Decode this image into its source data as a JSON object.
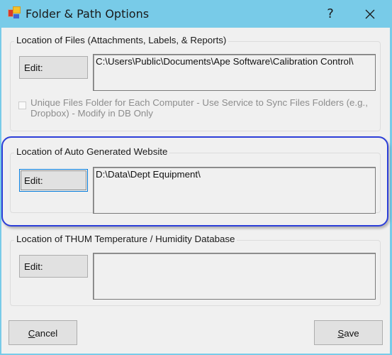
{
  "window": {
    "title": "Folder & Path Options",
    "help_label": "?",
    "close_icon": "close-x-icon",
    "app_icon": "folder-options-app-icon"
  },
  "groups": [
    {
      "label": "Location of Files (Attachments, Labels, & Reports)",
      "edit_label": "Edit:",
      "path": "C:\\Users\\Public\\Documents\\Ape Software\\Calibration Control\\",
      "checkbox": {
        "label": "Unique Files Folder for Each Computer - Use Service to Sync Files Folders (e.g., Dropbox) - Modify in DB Only",
        "checked": false,
        "enabled": false
      }
    },
    {
      "label": "Location of Auto Generated Website",
      "edit_label": "Edit:",
      "path": "D:\\Data\\Dept Equipment\\",
      "highlighted": true,
      "highlight_color": "#2c3ed8"
    },
    {
      "label": "Location of THUM Temperature / Humidity Database",
      "edit_label": "Edit:",
      "path": ""
    }
  ],
  "footer": {
    "cancel_mnemonic": "C",
    "cancel_rest": "ancel",
    "save_mnemonic": "S",
    "save_rest": "ave"
  },
  "colors": {
    "titlebar": "#78cbe8",
    "client": "#f0f0f0",
    "focus_border": "#0078d7"
  }
}
